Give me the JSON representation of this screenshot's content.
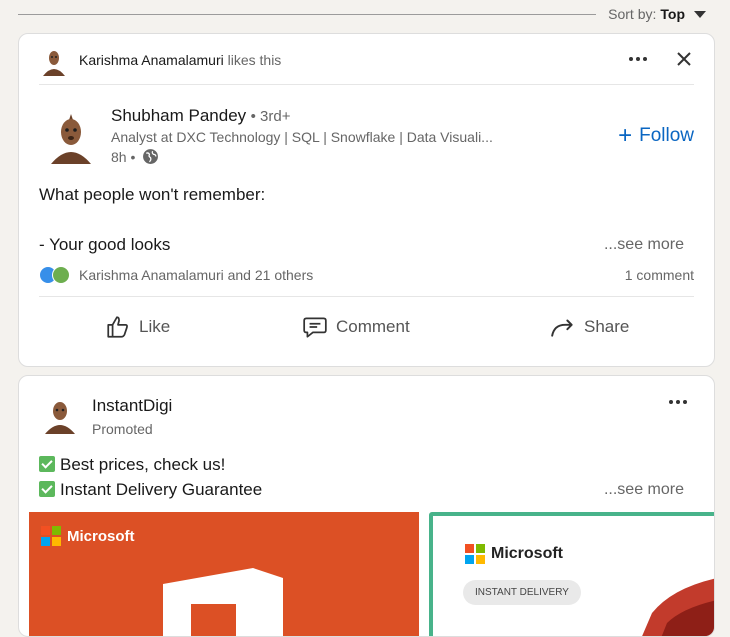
{
  "sort": {
    "label": "Sort by:",
    "value": "Top"
  },
  "post1": {
    "context": {
      "name": "Karishma Anamalamuri",
      "action": "likes this"
    },
    "author": {
      "name": "Shubham Pandey",
      "degree": "• 3rd+",
      "headline": "Analyst at DXC Technology | SQL | Snowflake | Data Visuali...",
      "time": "8h •"
    },
    "follow_label": "Follow",
    "text_line1": "What people won't remember:",
    "text_line2": "- Your good looks",
    "see_more": "...see more",
    "reactions_text": "Karishma Anamalamuri and 21 others",
    "comments_text": "1 comment",
    "actions": {
      "like": "Like",
      "comment": "Comment",
      "share": "Share"
    }
  },
  "post2": {
    "author": {
      "name": "InstantDigi",
      "sub": "Promoted"
    },
    "line1": "Best prices, check us!",
    "line2": "Instant Delivery Guarantee",
    "see_more": "...see more",
    "ad1": {
      "brand": "Microsoft"
    },
    "ad2": {
      "brand": "Microsoft",
      "badge": "INSTANT DELIVERY"
    }
  },
  "colors": {
    "link_blue": "#0a66c2",
    "office_orange": "#dc5025",
    "check_green": "#5cb85c",
    "ad_border_green": "#48b38a"
  },
  "icons": [
    "avatar",
    "more-icon",
    "close-icon",
    "globe-icon",
    "plus-icon",
    "like-reaction-icon",
    "support-reaction-icon",
    "thumbs-up-icon",
    "comment-icon",
    "share-icon",
    "check-icon",
    "microsoft-logo-icon",
    "caret-down-icon"
  ]
}
